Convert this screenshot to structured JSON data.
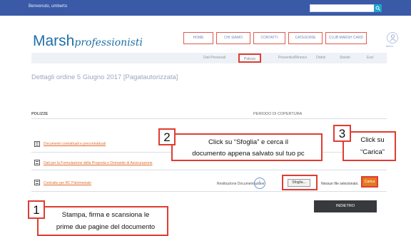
{
  "header": {
    "welcome": "Benvenuto, umberto",
    "brand_main": "Marsh",
    "brand_sub": "professionisti",
    "avatar_label": "Menu"
  },
  "main_nav": [
    "HOME",
    "CHI SIAMO",
    "CONTATTI",
    "CATEGORIE",
    "CLUB MARSH CARD"
  ],
  "sub_nav": [
    "Dati Personali",
    "Polizze",
    "Preventivi/Rinnovi",
    "Ordini",
    "Sinistri",
    "Esci"
  ],
  "page": {
    "order_title": "Dettagli ordine 5 Giugno 2017 [Pagatautorizzata]",
    "section_label": "POLIZZE",
    "coverage_label": "PERIODO DI COPERTURA"
  },
  "documents": [
    "Documenti contrattuali e precontrattuali",
    "Dati per la Formulazione della Proposta e Domande di Assicurazione",
    "Contratto per RC Patrimoniale"
  ],
  "upload": {
    "restitution_label": "Restituzione Documentazione",
    "browse_button": "Sfoglia...",
    "no_file_text": "Nessun file selezionato.",
    "upload_button": "Carica"
  },
  "back_button": "INDIETRO",
  "callouts": [
    {
      "number": "1",
      "line1": "Stampa, firma e scansiona le",
      "line2": "prime due pagine del documento"
    },
    {
      "number": "2",
      "line1": "Click su “Sfoglia” e cerca il",
      "line2": "documento appena salvato sul tuo pc"
    },
    {
      "number": "3",
      "line1": "Click su",
      "line2": "“Carica”"
    }
  ],
  "colors": {
    "topbar": "#3a5aa8",
    "brand": "#1f6fa6",
    "highlight": "#e03c32",
    "upload_button": "#e4791f",
    "back_button": "#37393d"
  },
  "icons": [
    "search-icon",
    "user-icon",
    "document-icon",
    "info-icon"
  ]
}
